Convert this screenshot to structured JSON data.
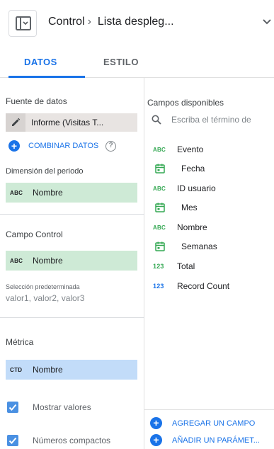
{
  "header": {
    "breadcrumb_root": "Control",
    "breadcrumb_separator": "›",
    "breadcrumb_title": "Lista despleg..."
  },
  "tabs": [
    {
      "label": "DATOS",
      "active": true
    },
    {
      "label": "ESTILO",
      "active": false
    }
  ],
  "left": {
    "data_source_label": "Fuente de datos",
    "data_source_value": "Informe (Visitas T...",
    "blend_label": "COMBINAR DATOS",
    "period_dimension_label": "Dimensión del periodo",
    "period_dimension_chip": {
      "type": "ABC",
      "label": "Nombre"
    },
    "control_field_label": "Campo Control",
    "control_field_chip": {
      "type": "ABC",
      "label": "Nombre"
    },
    "default_selection_label": "Selección predeterminada",
    "default_selection_placeholder": "valor1, valor2, valor3",
    "metric_label": "Métrica",
    "metric_chip": {
      "type": "CTD",
      "label": "Nombre"
    },
    "show_values_label": "Mostrar valores",
    "show_values_checked": true,
    "compact_numbers_label": "Números compactos",
    "compact_numbers_checked": true
  },
  "right": {
    "available_fields_label": "Campos disponibles",
    "search_placeholder": "Escriba el término de",
    "fields": [
      {
        "icon": "ABC",
        "kind": "text",
        "name": "Evento"
      },
      {
        "icon": "calendar",
        "kind": "date",
        "name": "Fecha"
      },
      {
        "icon": "ABC",
        "kind": "text",
        "name": "ID usuario"
      },
      {
        "icon": "calendar",
        "kind": "date",
        "name": "Mes"
      },
      {
        "icon": "ABC",
        "kind": "text",
        "name": "Nombre"
      },
      {
        "icon": "calendar",
        "kind": "date",
        "name": "Semanas"
      },
      {
        "icon": "123",
        "kind": "number-green",
        "name": "Total"
      },
      {
        "icon": "123",
        "kind": "number-blue",
        "name": "Record Count"
      }
    ],
    "add_field_label": "AGREGAR UN CAMPO",
    "add_parameter_label": "AÑADIR UN PARÁMET..."
  },
  "colors": {
    "accent": "#1a73e8",
    "dimension_chip": "#ceead6",
    "metric_chip": "#c2dcf9",
    "checkbox": "#4a90e2",
    "text_field_icon": "#34a853"
  }
}
